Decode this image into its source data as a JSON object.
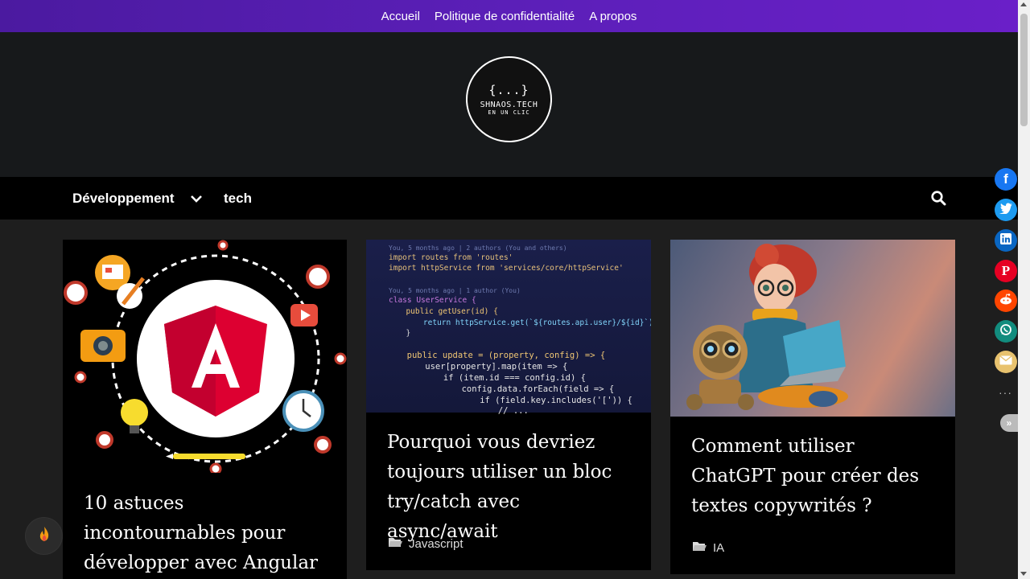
{
  "topbar": {
    "links": [
      "Accueil",
      "Politique de confidentialité",
      "A propos"
    ]
  },
  "logo": {
    "braces": "{...}",
    "name": "SHNAOS.TECH",
    "tagline": "EN UN CLIC"
  },
  "nav": {
    "items": [
      "Développement",
      "tech"
    ],
    "dropdown_icon": "chevron-down-icon",
    "search_icon": "search-icon"
  },
  "posts": [
    {
      "title": "10 astuces incontournables pour développer avec Angular",
      "image": "angular-illustration"
    },
    {
      "title": "Pourquoi vous devriez toujours utiliser un bloc try/catch avec async/await",
      "category": "Javascript",
      "image": "code-screenshot"
    },
    {
      "title": "Comment utiliser ChatGPT pour créer des textes copywrités ?",
      "category": "IA",
      "image": "girl-robot-laptop"
    }
  ],
  "code_snippet": [
    "You, 5 months ago | 2 authors (You and others)",
    "import routes from 'routes'",
    "import httpService from 'services/core/httpService'",
    "You, 5 months ago | 1 author (You)",
    "class UserService {",
    "  public getUser(id) {",
    "    return httpService.get(`${routes.api.user}/${id}`);",
    "  }",
    "  public update = (property, config) => {",
    "    user[property].map(item => {",
    "      if (item.id === config.id) {",
    "        config.data.forEach(field => {",
    "          if (field.key.includes('[')) {",
    "            // ..."
  ],
  "share": [
    {
      "network": "facebook",
      "icon": "facebook-icon",
      "color": "#1877f2"
    },
    {
      "network": "twitter",
      "icon": "twitter-icon",
      "color": "#1d9bf0"
    },
    {
      "network": "linkedin",
      "icon": "linkedin-icon",
      "color": "#0a66c2"
    },
    {
      "network": "pinterest",
      "icon": "pinterest-icon",
      "color": "#e60023"
    },
    {
      "network": "reddit",
      "icon": "reddit-icon",
      "color": "#ff4500"
    },
    {
      "network": "whatsapp",
      "icon": "whatsapp-icon",
      "color": "#128c7e"
    },
    {
      "network": "email",
      "icon": "email-icon",
      "color": "#e8c26e"
    }
  ],
  "share_more": "···",
  "share_collapse": "»",
  "colors": {
    "topbar": "#5b1fb8",
    "header": "#17191b",
    "nav": "#000000",
    "body": "#1e1e1e"
  }
}
